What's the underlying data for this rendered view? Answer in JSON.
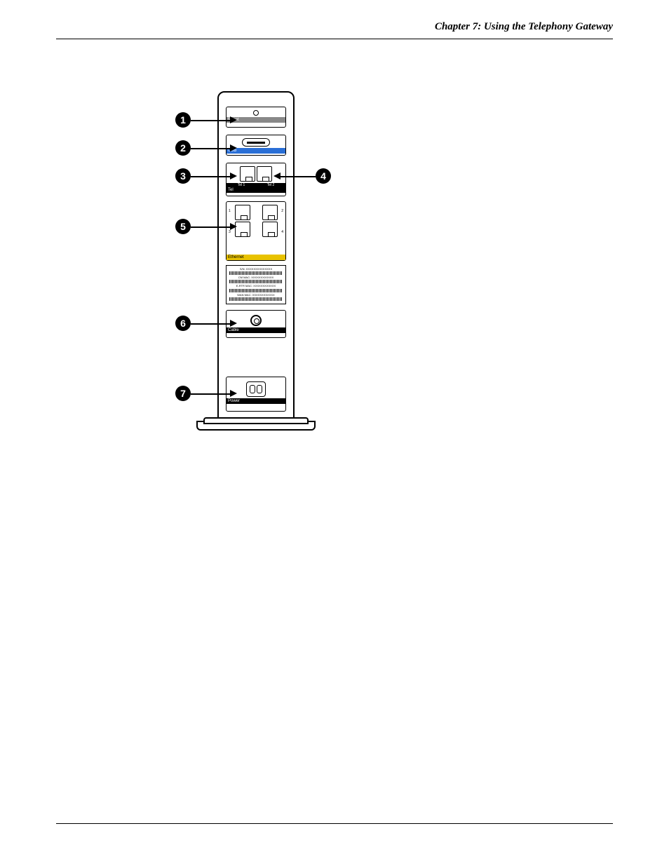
{
  "header": {
    "chapter_title": "Chapter 7: Using the Telephony Gateway"
  },
  "diagram": {
    "callouts": [
      {
        "num": "1",
        "side": "left",
        "target": "reset"
      },
      {
        "num": "2",
        "side": "left",
        "target": "usb"
      },
      {
        "num": "3",
        "side": "left",
        "target": "tel1"
      },
      {
        "num": "4",
        "side": "right",
        "target": "tel2"
      },
      {
        "num": "5",
        "side": "left",
        "target": "ethernet"
      },
      {
        "num": "6",
        "side": "left",
        "target": "cable"
      },
      {
        "num": "7",
        "side": "left",
        "target": "power"
      }
    ],
    "labels": {
      "reset": "Reset",
      "usb": "USB",
      "tel_section": "Tel",
      "tel1": "Tel 1",
      "tel2": "Tel 2",
      "ethernet": "Ethernet",
      "eth_ports": [
        "1",
        "2",
        "3",
        "4"
      ],
      "cable": "Cable",
      "power": "Power"
    },
    "sticker": {
      "line1": "S/N: XXXXXXXXXXXXXX",
      "line2": "CM MAC: XXXXXXXXXXXX",
      "line3": "E-RTR MAC: XXXXXXXXXXXX",
      "line4": "WAN MAC: XXXXXXXXXXXX"
    }
  }
}
